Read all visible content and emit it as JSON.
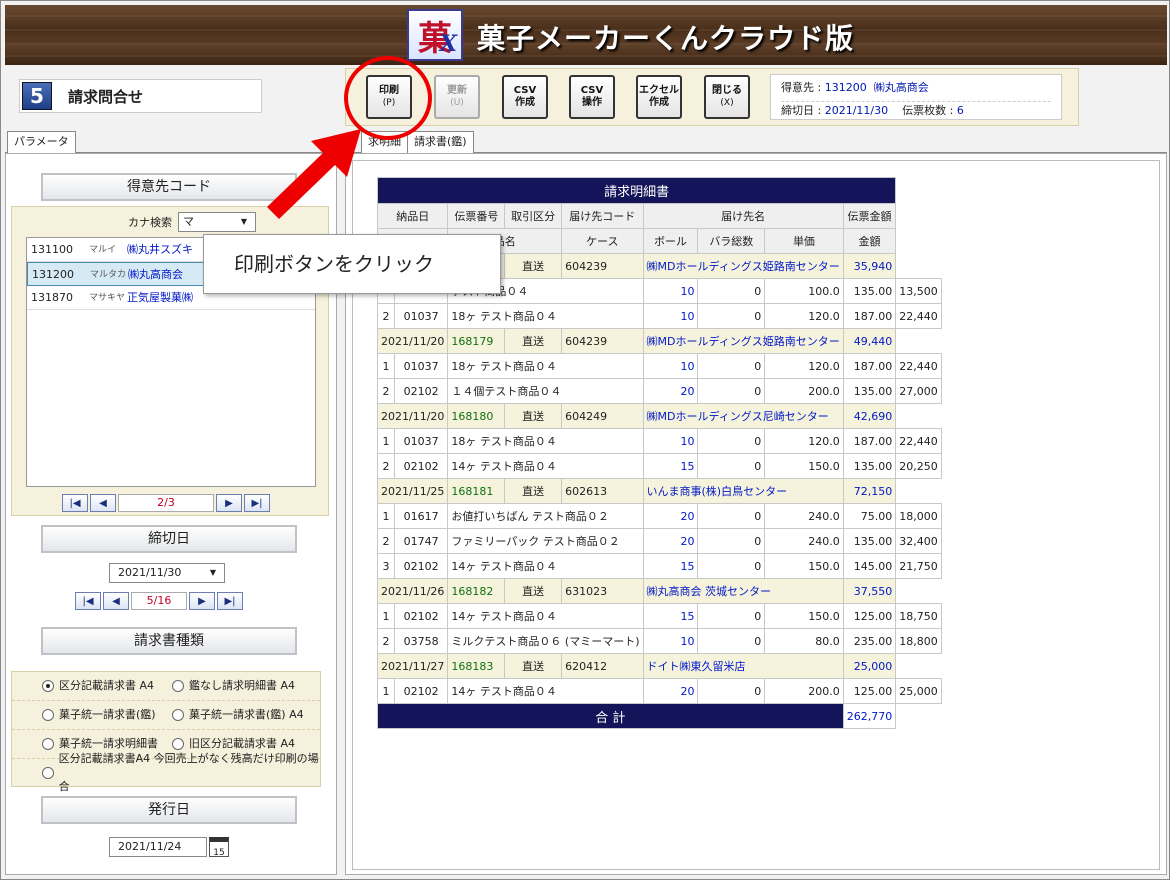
{
  "app": {
    "title": "菓子メーカーくんクラウド版",
    "logo_char": "菓",
    "logo_sub": "X"
  },
  "screen": {
    "number": "5",
    "title": "請求問合せ"
  },
  "toolbar": [
    {
      "label": "印刷",
      "key": "(P)"
    },
    {
      "label": "更新",
      "key": "(U)"
    },
    {
      "label": "CSV",
      "key": "作成"
    },
    {
      "label": "CSV",
      "key": "操作"
    },
    {
      "label": "エクセル",
      "key": "作成"
    },
    {
      "label": "閉じる",
      "key": "(X)"
    }
  ],
  "info": {
    "customer_label": "得意先 :",
    "customer_code": "131200",
    "customer_name": "㈱丸高商会",
    "cutoff_label": "締切日 :",
    "cutoff_date": "2021/11/30",
    "slips_label": "伝票枚数 :",
    "slips_count": "6"
  },
  "left_tabs": [
    "パラメータ"
  ],
  "right_tabs": [
    "求明細",
    "請求書(鑑)"
  ],
  "left": {
    "customer_heading": "得意先コード",
    "kana_label": "カナ検索",
    "kana_value": "マ",
    "customers": [
      {
        "code": "131100",
        "kana": "マルイ",
        "name": "㈱丸井スズキ"
      },
      {
        "code": "131200",
        "kana": "マルタカ",
        "name": "㈱丸高商会"
      },
      {
        "code": "131870",
        "kana": "マサキヤ",
        "name": "正気屋製菓㈱"
      }
    ],
    "customer_page": "2/3",
    "cutoff_heading": "締切日",
    "cutoff_value": "2021/11/30",
    "cutoff_page": "5/16",
    "type_heading": "請求書種類",
    "types": [
      "区分記載請求書 A4",
      "鑑なし請求明細書 A4",
      "菓子統一請求書(鑑)",
      "菓子統一請求書(鑑) A4",
      "菓子統一請求明細書",
      "旧区分記載請求書 A4",
      "区分記載請求書A4 今回売上がなく残高だけ印刷の場合"
    ],
    "issue_heading": "発行日",
    "issue_value": "2021/11/24",
    "cal_day": "15"
  },
  "invoice": {
    "title": "請求明細書",
    "head1": [
      "納品日",
      "伝票番号",
      "取引区分",
      "届け先コード",
      "届け先名",
      "伝票金額"
    ],
    "head2": [
      "品名",
      "ケース",
      "ボール",
      "バラ総数",
      "単価",
      "金額"
    ],
    "groups": [
      {
        "date": "",
        "slip": "",
        "kbn": "直送",
        "dest": "604239",
        "name": "㈱MDホールディングス姫路南センター",
        "amount": "35,940",
        "items": [
          {
            "no": "",
            "code": "",
            "item": "テスト商品０４",
            "case": "10",
            "ball": "0",
            "bara": "100.0",
            "price": "135.00",
            "amt": "13,500"
          },
          {
            "no": "2",
            "code": "01037",
            "item": "18ヶ テスト商品０４",
            "case": "10",
            "ball": "0",
            "bara": "120.0",
            "price": "187.00",
            "amt": "22,440"
          }
        ]
      },
      {
        "date": "2021/11/20",
        "slip": "168179",
        "kbn": "直送",
        "dest": "604239",
        "name": "㈱MDホールディングス姫路南センター",
        "amount": "49,440",
        "items": [
          {
            "no": "1",
            "code": "01037",
            "item": "18ヶ テスト商品０４",
            "case": "10",
            "ball": "0",
            "bara": "120.0",
            "price": "187.00",
            "amt": "22,440"
          },
          {
            "no": "2",
            "code": "02102",
            "item": "１４個テスト商品０４",
            "case": "20",
            "ball": "0",
            "bara": "200.0",
            "price": "135.00",
            "amt": "27,000"
          }
        ]
      },
      {
        "date": "2021/11/20",
        "slip": "168180",
        "kbn": "直送",
        "dest": "604249",
        "name": "㈱MDホールディングス尼崎センター",
        "amount": "42,690",
        "items": [
          {
            "no": "1",
            "code": "01037",
            "item": "18ヶ テスト商品０４",
            "case": "10",
            "ball": "0",
            "bara": "120.0",
            "price": "187.00",
            "amt": "22,440"
          },
          {
            "no": "2",
            "code": "02102",
            "item": "14ヶ テスト商品０４",
            "case": "15",
            "ball": "0",
            "bara": "150.0",
            "price": "135.00",
            "amt": "20,250"
          }
        ]
      },
      {
        "date": "2021/11/25",
        "slip": "168181",
        "kbn": "直送",
        "dest": "602613",
        "name": "いんま商事(株)白鳥センター",
        "amount": "72,150",
        "items": [
          {
            "no": "1",
            "code": "01617",
            "item": "お値打いちばん テスト商品０２",
            "case": "20",
            "ball": "0",
            "bara": "240.0",
            "price": "75.00",
            "amt": "18,000"
          },
          {
            "no": "2",
            "code": "01747",
            "item": "ファミリーパック テスト商品０２",
            "case": "20",
            "ball": "0",
            "bara": "240.0",
            "price": "135.00",
            "amt": "32,400"
          },
          {
            "no": "3",
            "code": "02102",
            "item": "14ヶ テスト商品０４",
            "case": "15",
            "ball": "0",
            "bara": "150.0",
            "price": "145.00",
            "amt": "21,750"
          }
        ]
      },
      {
        "date": "2021/11/26",
        "slip": "168182",
        "kbn": "直送",
        "dest": "631023",
        "name": "㈱丸高商会 茨城センター",
        "amount": "37,550",
        "items": [
          {
            "no": "1",
            "code": "02102",
            "item": "14ヶ テスト商品０４",
            "case": "15",
            "ball": "0",
            "bara": "150.0",
            "price": "125.00",
            "amt": "18,750"
          },
          {
            "no": "2",
            "code": "03758",
            "item": "ミルクテスト商品０６ (マミーマート)",
            "case": "10",
            "ball": "0",
            "bara": "80.0",
            "price": "235.00",
            "amt": "18,800"
          }
        ]
      },
      {
        "date": "2021/11/27",
        "slip": "168183",
        "kbn": "直送",
        "dest": "620412",
        "name": "ドイト㈱東久留米店",
        "amount": "25,000",
        "items": [
          {
            "no": "1",
            "code": "02102",
            "item": "14ヶ テスト商品０４",
            "case": "20",
            "ball": "0",
            "bara": "200.0",
            "price": "125.00",
            "amt": "25,000"
          }
        ]
      }
    ],
    "total_label": "合 計",
    "total": "262,770"
  },
  "tooltip": "印刷ボタンをクリック",
  "colors": {
    "navy": "#14145a",
    "highlight": "#e00000",
    "accent_blue": "#0018c8",
    "slip_green": "#107010"
  }
}
